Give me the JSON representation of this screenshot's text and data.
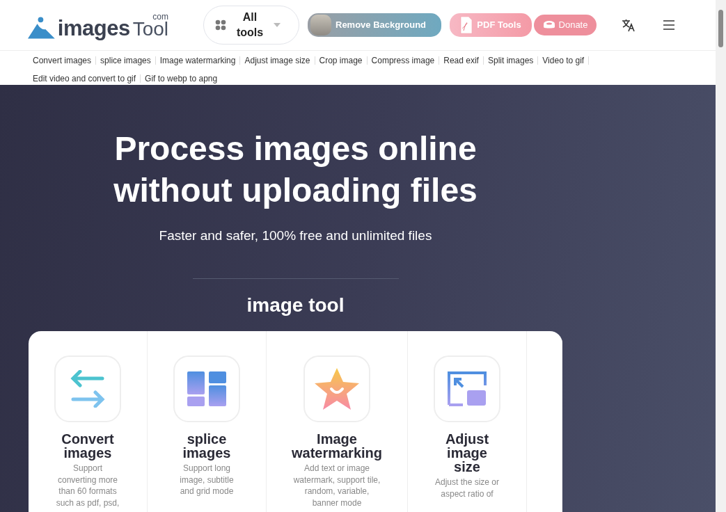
{
  "header": {
    "logo": {
      "name": "images",
      "suffix": "Tool",
      "domain": "com"
    },
    "all_tools": "All tools",
    "promos": [
      {
        "kind": "remove-bg",
        "label": "Remove Background"
      },
      {
        "kind": "pdf",
        "label": "PDF Tools"
      },
      {
        "kind": "donate",
        "label": "Donate"
      }
    ]
  },
  "nav_links": [
    "Convert images",
    "splice images",
    "Image watermarking",
    "Adjust image size",
    "Crop image",
    "Compress image",
    "Read exif",
    "Split images",
    "Video to gif",
    "Edit video and convert to gif",
    "Gif to webp to apng"
  ],
  "hero": {
    "title_lines": [
      "Process images online",
      "without uploading files"
    ],
    "subtitle": "Faster and safer, 100% free and unlimited files"
  },
  "section_title": "image tool",
  "tools": [
    {
      "kind": "convert",
      "title": "Convert images",
      "description": "Support converting more than 60 formats such as pdf, psd,"
    },
    {
      "kind": "splice",
      "title": "splice images",
      "description": "Support long image, subtitle and grid mode"
    },
    {
      "kind": "watermark",
      "title": "Image watermarking",
      "description": "Add text or image watermark, support tile, random, variable, banner mode"
    },
    {
      "kind": "resize",
      "title": "Adjust image size",
      "description": "Adjust the size or aspect ratio of"
    }
  ]
}
